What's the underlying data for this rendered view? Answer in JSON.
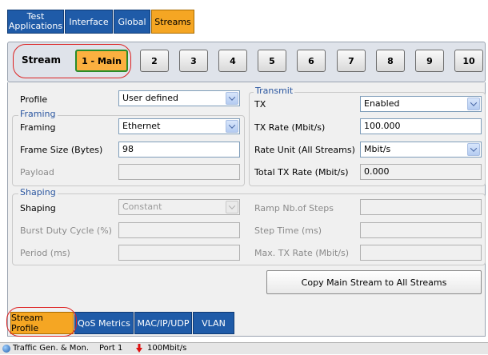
{
  "top_tabs": [
    {
      "line1": "Test",
      "line2": "Applications"
    },
    {
      "label": "Interface"
    },
    {
      "label": "Global"
    },
    {
      "label": "Streams"
    }
  ],
  "stream_bar": {
    "label": "Stream",
    "buttons": [
      "1 - Main",
      "2",
      "3",
      "4",
      "5",
      "6",
      "7",
      "8",
      "9",
      "10"
    ],
    "active": "1 - Main"
  },
  "profile": {
    "label": "Profile",
    "value": "User defined"
  },
  "framing": {
    "title": "Framing",
    "framing_label": "Framing",
    "framing_value": "Ethernet",
    "frame_size_label": "Frame Size (Bytes)",
    "frame_size_value": "98",
    "payload_label": "Payload",
    "payload_value": ""
  },
  "transmit": {
    "title": "Transmit",
    "tx_label": "TX",
    "tx_value": "Enabled",
    "tx_rate_label": "TX Rate (Mbit/s)",
    "tx_rate_value": "100.000",
    "rate_unit_label": "Rate Unit (All Streams)",
    "rate_unit_value": "Mbit/s",
    "total_label": "Total TX Rate (Mbit/s)",
    "total_value": "0.000"
  },
  "shaping": {
    "title": "Shaping",
    "shaping_label": "Shaping",
    "shaping_value": "Constant",
    "burst_label": "Burst Duty Cycle (%)",
    "burst_value": "",
    "period_label": "Period (ms)",
    "period_value": "",
    "ramp_label": "Ramp Nb.of Steps",
    "ramp_value": "",
    "step_label": "Step Time (ms)",
    "step_value": "",
    "max_label": "Max. TX Rate (Mbit/s)",
    "max_value": ""
  },
  "copy_button": "Copy Main Stream to All Streams",
  "bottom_tabs": [
    "Stream Profile",
    "QoS Metrics",
    "MAC/IP/UDP",
    "VLAN"
  ],
  "status": {
    "app": "Traffic Gen. & Mon.",
    "port": "Port 1",
    "rate": "100Mbit/s"
  },
  "colors": {
    "tab_blue": "#1f5ba8",
    "tab_active": "#f5a623",
    "highlight_red": "#d22222"
  }
}
